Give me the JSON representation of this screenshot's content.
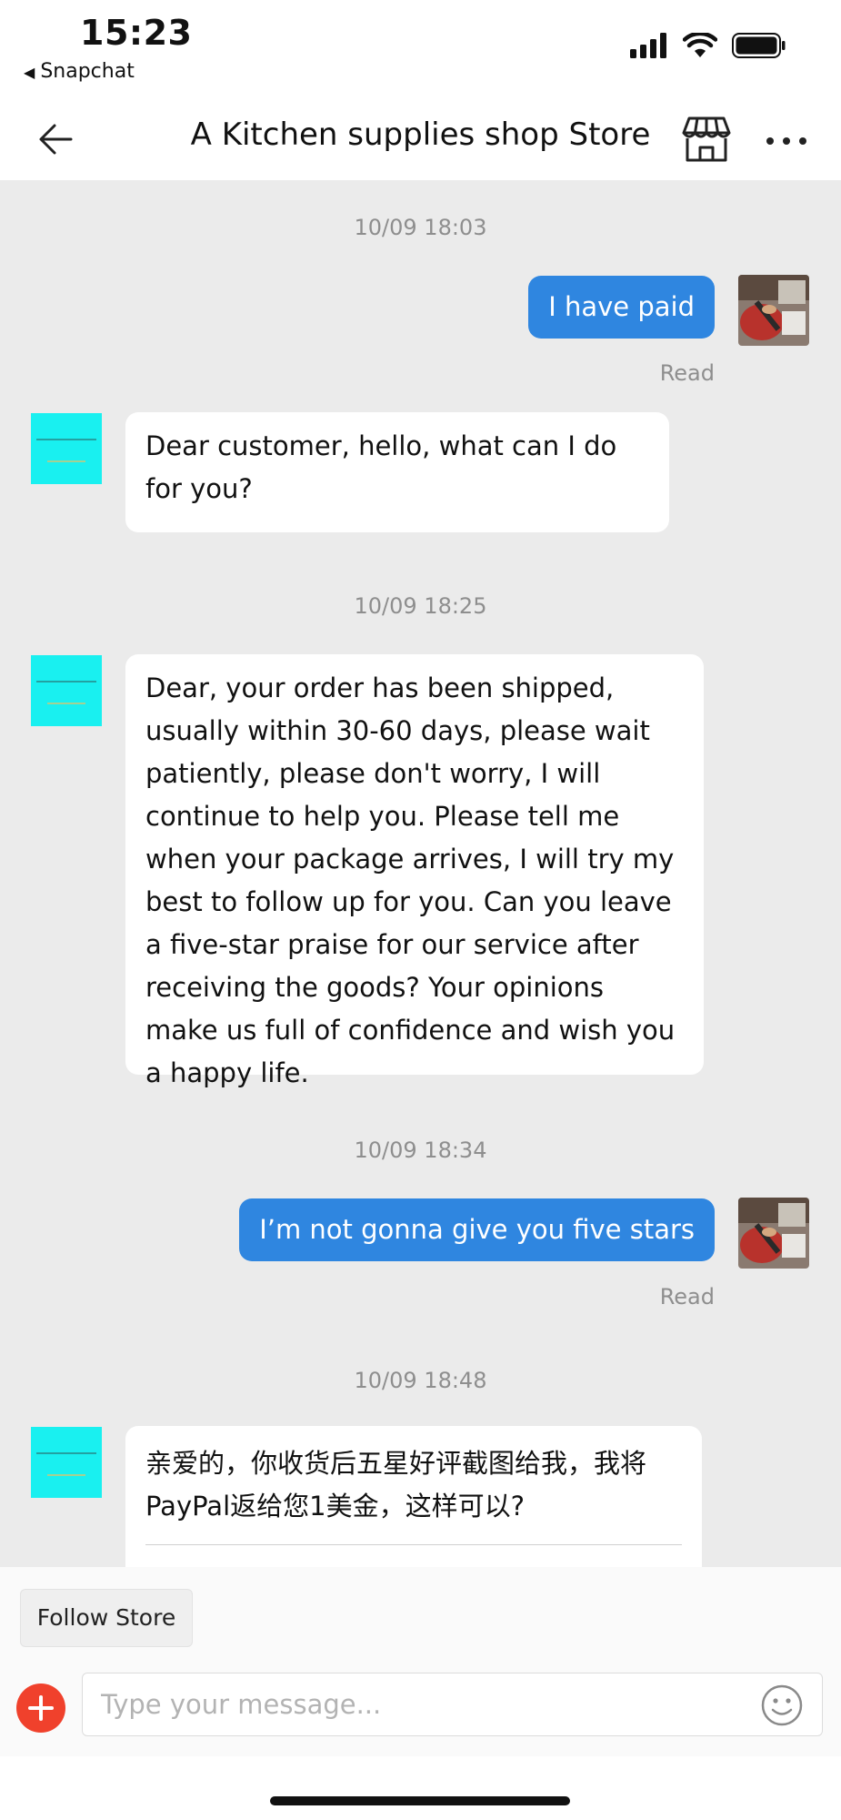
{
  "status_bar": {
    "time": "15:23",
    "back_app": "Snapchat"
  },
  "header": {
    "title": "A Kitchen supplies shop Store"
  },
  "messages": {
    "m1": {
      "timestamp": "10/09 18:03",
      "text": "I have paid",
      "status": "Read"
    },
    "m2": {
      "text": "Dear customer, hello, what can I do for you?"
    },
    "m3": {
      "timestamp": "10/09 18:25",
      "text": "Dear, your order has been shipped, usually within 30-60 days, please wait patiently, please don't worry, I will continue to help you. Please tell me when your package arrives, I will try my best to follow up for you. Can you leave a five-star praise for our service after receiving the goods? Your opinions make us full of confidence and wish you a happy life."
    },
    "m4": {
      "timestamp": "10/09 18:34",
      "text": "I’m not gonna give you five stars",
      "status": "Read"
    },
    "m5": {
      "timestamp": "10/09 18:48",
      "text": "亲爱的，你收货后五星好评截图给我，我将PayPal返给您1美金，这样可以?"
    }
  },
  "footer": {
    "follow_label": "Follow Store",
    "input_placeholder": "Type your message..."
  },
  "colors": {
    "outgoing_bubble": "#2f86e0",
    "incoming_bubble": "#ffffff",
    "chat_background": "#ebebeb",
    "plus_button": "#f0412c",
    "store_avatar": "#19f0f0"
  },
  "icons": [
    "back-arrow-icon",
    "store-icon",
    "more-icon",
    "plus-icon",
    "emoji-icon",
    "signal-icon",
    "wifi-icon",
    "battery-icon"
  ]
}
